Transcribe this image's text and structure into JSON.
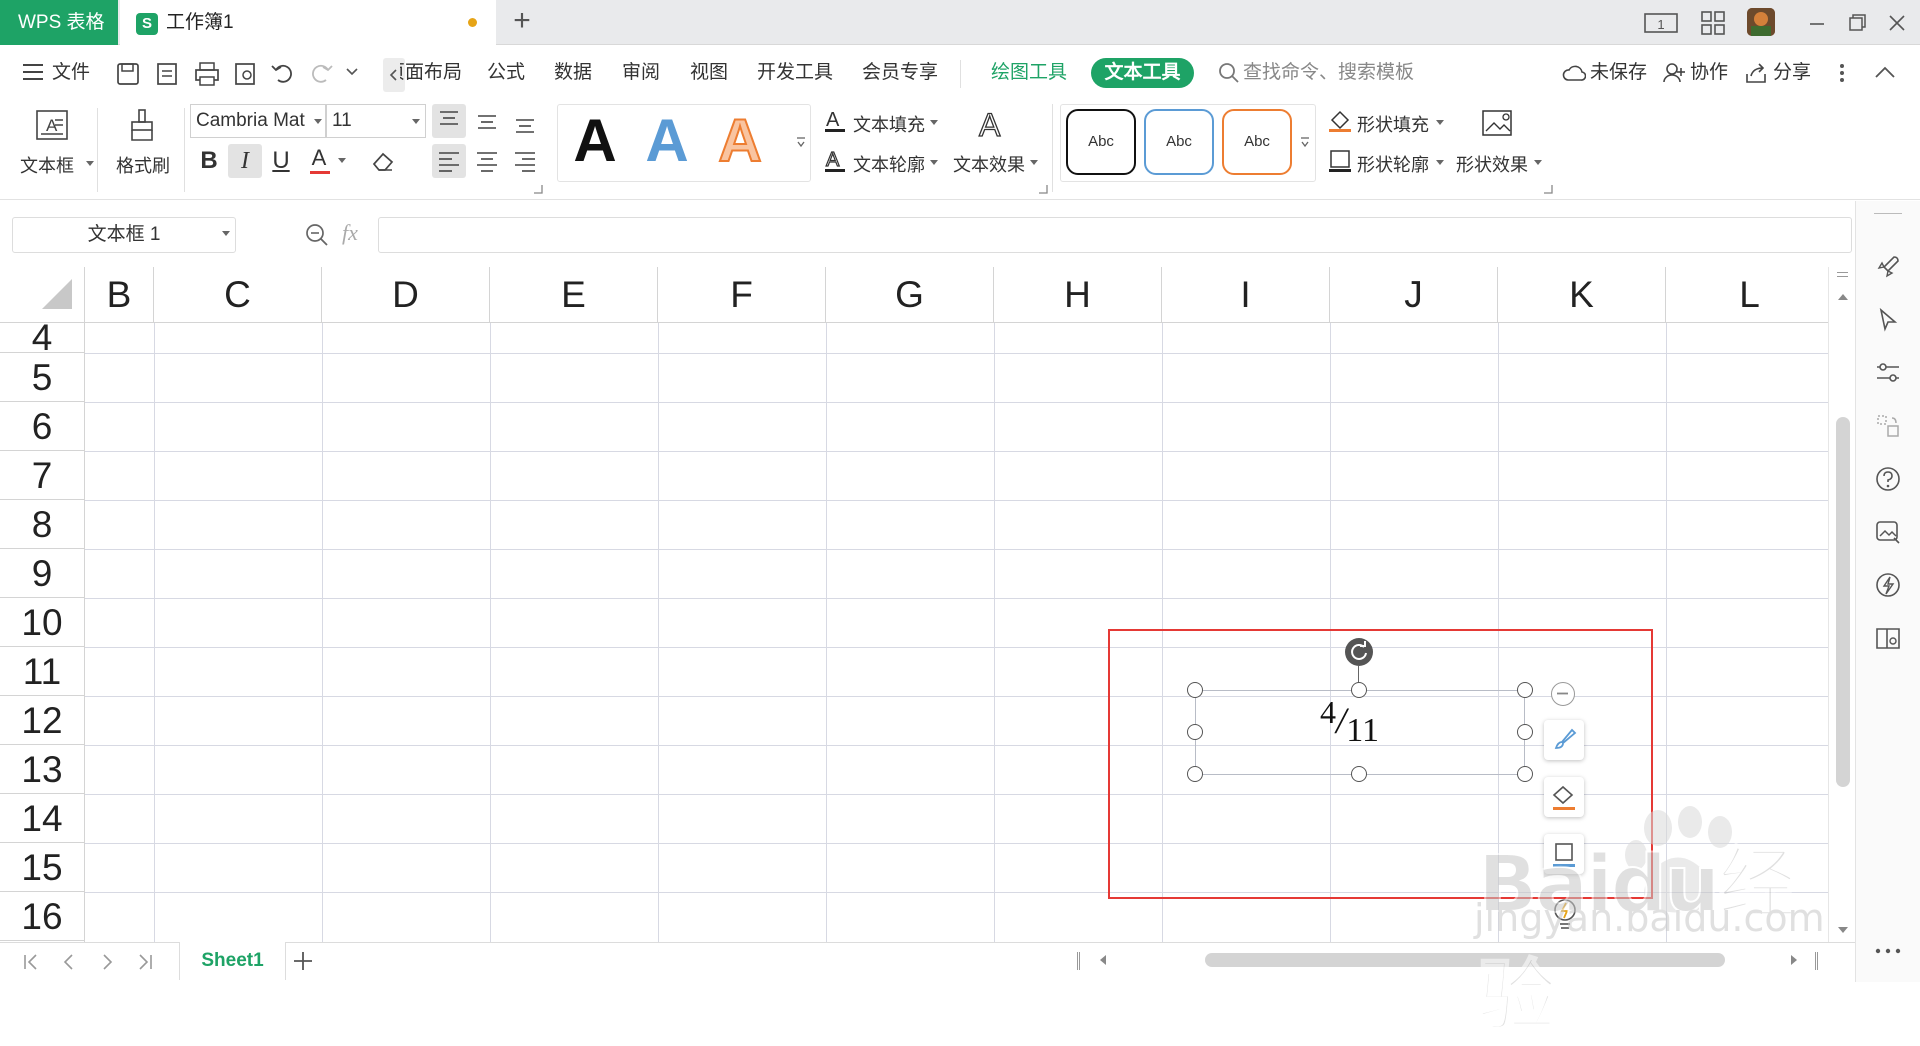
{
  "titlebar": {
    "app_name": "WPS 表格",
    "doc_icon_letter": "S",
    "doc_name": "工作簿1"
  },
  "menu": {
    "file": "文件",
    "items": [
      "页面布局",
      "公式",
      "数据",
      "审阅",
      "视图",
      "开发工具",
      "会员专享"
    ],
    "drawing_tools": "绘图工具",
    "text_tools": "文本工具",
    "search_placeholder": "查找命令、搜索模板",
    "unsaved": "未保存",
    "collaborate": "协作",
    "share": "分享"
  },
  "ribbon": {
    "textbox": "文本框",
    "format_painter": "格式刷",
    "font_name": "Cambria Mat",
    "font_size": "11",
    "bold": "B",
    "italic": "I",
    "underline": "U",
    "font_color": "A",
    "wordart_sample": "A",
    "text_fill": "文本填充",
    "text_outline": "文本轮廓",
    "text_effect": "文本效果",
    "shape_style_sample": "Abc",
    "shape_fill": "形状填充",
    "shape_outline": "形状轮廓",
    "shape_effect": "形状效果"
  },
  "formula_bar": {
    "name_box": "文本框 1",
    "fx": "fx",
    "value": ""
  },
  "sheet": {
    "columns": [
      "B",
      "C",
      "D",
      "E",
      "F",
      "G",
      "H",
      "I",
      "J",
      "K",
      "L"
    ],
    "rows": [
      "4",
      "5",
      "6",
      "7",
      "8",
      "9",
      "10",
      "11",
      "12",
      "13",
      "14",
      "15",
      "16"
    ],
    "fraction_numerator": "4",
    "fraction_slash": "/",
    "fraction_denominator": "11"
  },
  "tabs": {
    "active_sheet": "Sheet1"
  },
  "watermark": {
    "brand": "Baidu经验",
    "url": "jingyan.baidu.com"
  },
  "colors": {
    "brand_green": "#1ea366",
    "highlight_red": "#e53935",
    "unsaved_dot": "#e6a417"
  }
}
